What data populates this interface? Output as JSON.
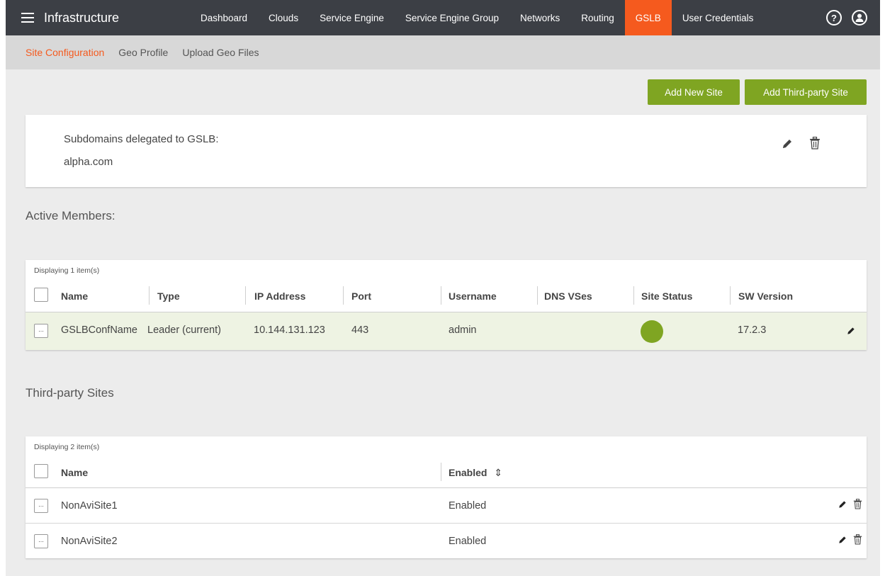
{
  "nav": {
    "title": "Infrastructure",
    "items": [
      "Dashboard",
      "Clouds",
      "Service Engine",
      "Service Engine Group",
      "Networks",
      "Routing",
      "GSLB",
      "User Credentials"
    ],
    "active": "GSLB",
    "help_icon": "?"
  },
  "subnav": {
    "items": [
      "Site Configuration",
      "Geo Profile",
      "Upload Geo Files"
    ],
    "active": "Site Configuration"
  },
  "actions": {
    "add_new_site": "Add New Site",
    "add_third_party_site": "Add Third-party Site"
  },
  "subdomains": {
    "label": "Subdomains delegated to GSLB:",
    "value": "alpha.com"
  },
  "active_members": {
    "title": "Active Members:",
    "count_text": "Displaying 1 item(s)",
    "columns": [
      "Name",
      "Type",
      "IP Address",
      "Port",
      "Username",
      "DNS VSes",
      "Site Status",
      "SW Version"
    ],
    "rows": [
      {
        "name": "GSLBConfName",
        "type": "Leader (current)",
        "ip": "10.144.131.123",
        "port": "443",
        "username": "admin",
        "dns_vses": "",
        "status_color": "#7fa522",
        "sw_version": "17.2.3",
        "menu": "..."
      }
    ]
  },
  "third_party": {
    "title": "Third-party Sites",
    "count_text": "Displaying 2 item(s)",
    "columns": [
      "Name",
      "Enabled"
    ],
    "sort_icon": "⇕",
    "rows": [
      {
        "name": "NonAviSite1",
        "enabled": "Enabled",
        "menu": "..."
      },
      {
        "name": "NonAviSite2",
        "enabled": "Enabled",
        "menu": "..."
      }
    ]
  },
  "colors": {
    "accent": "#f55a1e",
    "green": "#7fa522",
    "nav_bg": "#3c3f45"
  }
}
